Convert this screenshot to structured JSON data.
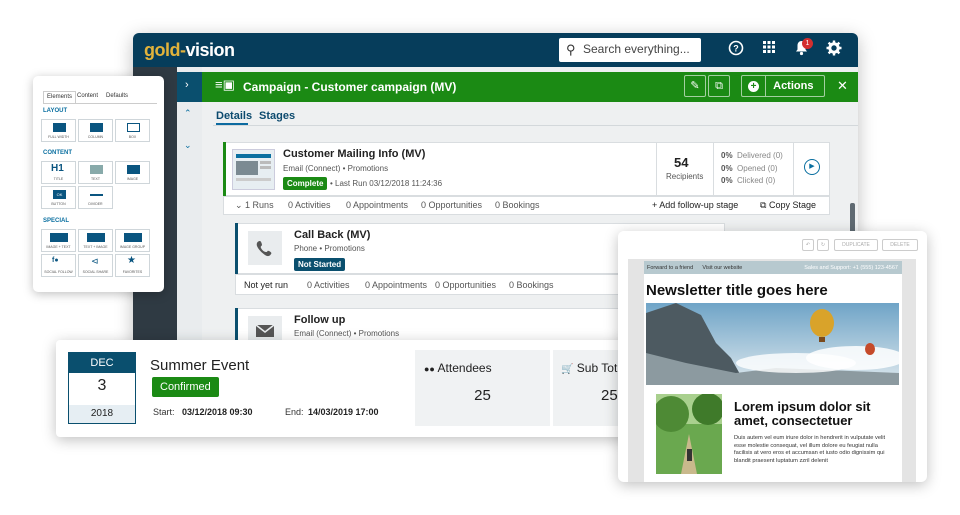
{
  "app": {
    "logo_gold": "gold",
    "logo_sep": "-",
    "logo_vision": "vision",
    "search_placeholder": "Search everything...",
    "notification_count": "1"
  },
  "campaign": {
    "title": "Campaign - Customer campaign (MV)",
    "actions_label": "Actions"
  },
  "tabs": [
    "Details",
    "Stages"
  ],
  "stages": [
    {
      "title": "Customer Mailing Info (MV)",
      "channel": "Email (Connect)",
      "category": "• Promotions",
      "status": "Complete",
      "last_run": "• Last Run 03/12/2018 11:24:36",
      "recipients": "54",
      "recipients_label": "Recipients",
      "metrics": [
        {
          "pct": "0%",
          "label": "Delivered (0)"
        },
        {
          "pct": "0%",
          "label": "Opened (0)"
        },
        {
          "pct": "0%",
          "label": "Clicked (0)"
        }
      ],
      "runs": "1 Runs",
      "activities": "0 Activities",
      "appointments": "0 Appointments",
      "opportunities": "0 Opportunities",
      "bookings": "0 Bookings",
      "add_followup": "+ Add follow-up stage",
      "copy_stage": "Copy Stage"
    },
    {
      "title": "Call Back (MV)",
      "channel": "Phone",
      "category": "• Promotions",
      "status": "Not Started",
      "runs": "Not yet run",
      "activities": "0 Activities",
      "appointments": "0 Appointments",
      "opportunities": "0 Opportunities",
      "bookings": "0 Bookings"
    },
    {
      "title": "Follow up",
      "channel": "Email (Connect)",
      "category": "• Promotions"
    }
  ],
  "elements_panel": {
    "tabs": [
      "Elements",
      "Content",
      "Defaults"
    ],
    "sections": [
      {
        "name": "LAYOUT",
        "items": [
          "FULL WIDTH",
          "COLUMN",
          "BOX"
        ]
      },
      {
        "name": "CONTENT",
        "items": [
          "TITLE",
          "TEXT",
          "IMAGE",
          "BUTTON",
          "DIVIDER"
        ]
      },
      {
        "name": "SPECIAL",
        "items": [
          "IMAGE + TEXT",
          "TEXT + IMAGE",
          "IMAGE GROUP",
          "SOCIAL FOLLOW",
          "SOCIAL SHARE",
          "FAVORITES"
        ]
      }
    ],
    "title_glyph": "H1",
    "button_glyph": "OK"
  },
  "event": {
    "month": "DEC",
    "day": "3",
    "year": "2018",
    "title": "Summer Event",
    "status": "Confirmed",
    "start_label": "Start:",
    "start": "03/12/2018 09:30",
    "end_label": "End:",
    "end": "14/03/2019 17:00",
    "attendees_label": "Attendees",
    "attendees": "25",
    "subtotal_label": "Sub Tot",
    "subtotal": "25"
  },
  "newsletter": {
    "toolbar": [
      "DUPLICATE",
      "DELETE"
    ],
    "strip_left": "Forward to a friend",
    "strip_mid": "Visit our website",
    "strip_right": "Sales and Support: +1 (555) 123-4567",
    "title": "Newsletter title goes here",
    "heading": "Lorem ipsum dolor sit amet, consectetuer",
    "body": "Duis autem vel eum iriure dolor in hendrerit in vulputate velit esse molestie consequat, vel illum dolore eu feugiat nulla facilisis at vero eros et accumsan et iusto odio dignissim qui blandit praesent luptatum zzril delenit"
  },
  "colors": {
    "navy": "#063d5b",
    "green": "#1b8a14",
    "gold": "#e2b33b"
  }
}
